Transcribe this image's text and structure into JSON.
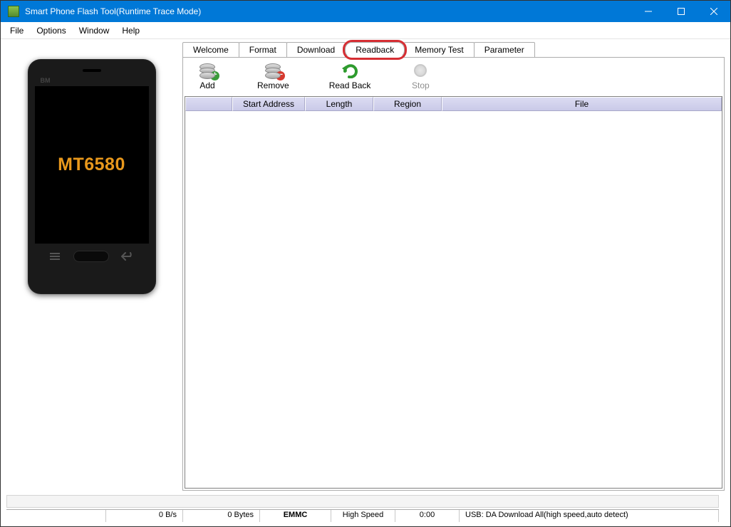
{
  "window": {
    "title": "Smart Phone Flash Tool(Runtime Trace Mode)"
  },
  "menu": {
    "file": "File",
    "options": "Options",
    "window": "Window",
    "help": "Help"
  },
  "tabs": {
    "welcome": "Welcome",
    "format": "Format",
    "download": "Download",
    "readback": "Readback",
    "memory_test": "Memory Test",
    "parameter": "Parameter"
  },
  "toolbar": {
    "add": "Add",
    "remove": "Remove",
    "read_back": "Read Back",
    "stop": "Stop"
  },
  "table": {
    "headers": {
      "blank": "",
      "start_address": "Start Address",
      "length": "Length",
      "region": "Region",
      "file": "File"
    }
  },
  "phone": {
    "brand": "BM",
    "chip": "MT6580"
  },
  "status": {
    "rate": "0 B/s",
    "bytes": "0 Bytes",
    "storage": "EMMC",
    "speed": "High Speed",
    "time": "0:00",
    "usb": "USB: DA Download All(high speed,auto detect)"
  }
}
